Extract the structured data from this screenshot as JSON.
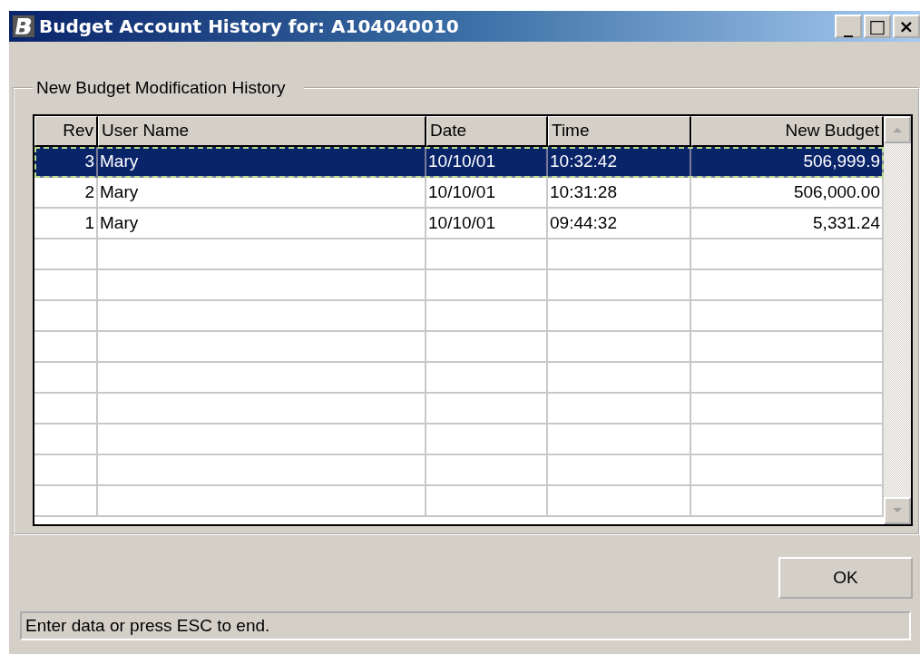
{
  "window": {
    "title": "Budget Account History for: A104040010",
    "controls": [
      "_",
      "□",
      "×"
    ]
  },
  "group": {
    "label": "New Budget Modification History"
  },
  "table": {
    "columns": [
      {
        "label": "Rev"
      },
      {
        "label": "User Name"
      },
      {
        "label": "Date"
      },
      {
        "label": "Time"
      },
      {
        "label": "New Budget"
      }
    ],
    "rows": [
      {
        "selected": true,
        "cells": [
          "3",
          "Mary",
          "10/10/01",
          "10:32:42",
          "506,999.9"
        ]
      },
      {
        "selected": false,
        "cells": [
          "2",
          "Mary",
          "10/10/01",
          "10:31:28",
          "506,000.00"
        ]
      },
      {
        "selected": false,
        "cells": [
          "1",
          "Mary",
          "10/10/01",
          "09:44:32",
          "5,331.24"
        ]
      }
    ]
  },
  "buttons": [
    "OK"
  ],
  "status_bar": "Enter data or press ESC to end."
}
